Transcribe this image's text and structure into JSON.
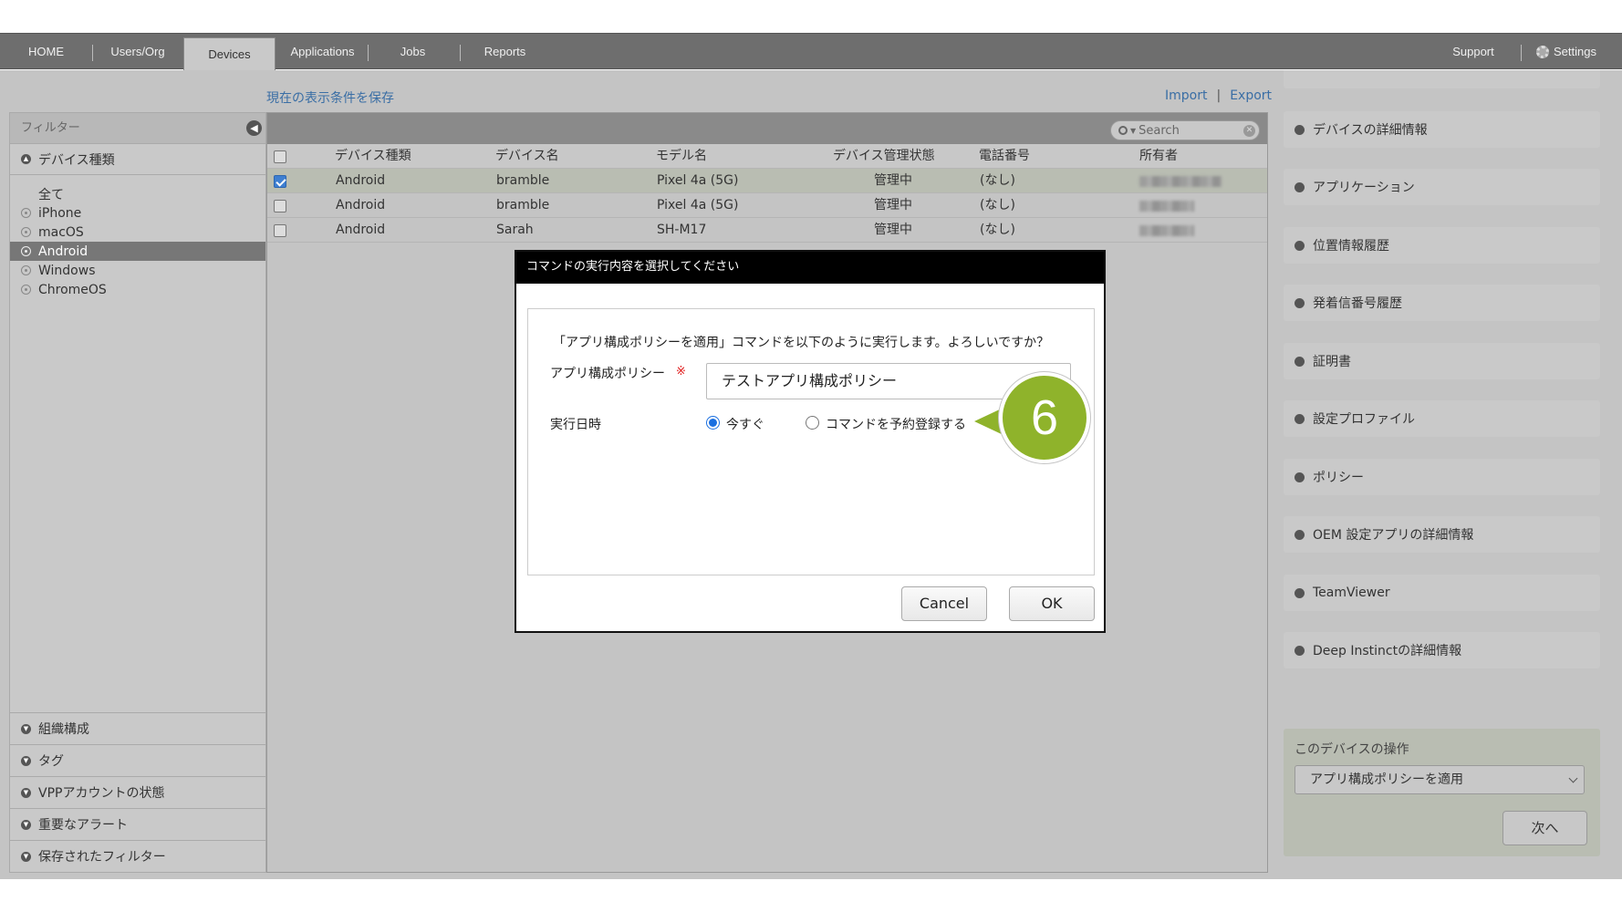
{
  "nav": {
    "tabs": [
      {
        "label": "HOME"
      },
      {
        "label": "Users/Org"
      },
      {
        "label": "Devices"
      },
      {
        "label": "Applications"
      },
      {
        "label": "Jobs"
      },
      {
        "label": "Reports"
      }
    ],
    "support": "Support",
    "settings": "Settings"
  },
  "toolbar": {
    "save_view": "現在の表示条件を保存",
    "import": "Import",
    "sep": "|",
    "export": "Export"
  },
  "filter": {
    "title": "フィルター",
    "device_type": "デバイス種類",
    "items": [
      "全て",
      "iPhone",
      "macOS",
      "Android",
      "Windows",
      "ChromeOS"
    ],
    "active_item": "Android",
    "bottom_sections": [
      "組織構成",
      "タグ",
      "VPPアカウントの状態",
      "重要なアラート",
      "保存されたフィルター"
    ]
  },
  "table": {
    "search_placeholder": "Search",
    "headers": [
      "デバイス種類",
      "デバイス名",
      "モデル名",
      "デバイス管理状態",
      "電話番号",
      "所有者"
    ],
    "rows": [
      {
        "type": "Android",
        "name": "bramble",
        "model": "Pixel 4a (5G)",
        "status": "管理中",
        "phone": "(なし)",
        "checked": true
      },
      {
        "type": "Android",
        "name": "bramble",
        "model": "Pixel 4a (5G)",
        "status": "管理中",
        "phone": "(なし)",
        "checked": false
      },
      {
        "type": "Android",
        "name": "Sarah",
        "model": "SH-M17",
        "status": "管理中",
        "phone": "(なし)",
        "checked": false
      }
    ]
  },
  "right_panel": {
    "items": [
      "デバイスの詳細情報",
      "アプリケーション",
      "位置情報履歴",
      "発着信番号履歴",
      "証明書",
      "設定プロファイル",
      "ポリシー",
      "OEM 設定アプリの詳細情報",
      "TeamViewer",
      "Deep Instinctの詳細情報"
    ],
    "operation_title": "このデバイスの操作",
    "operation_selected": "アプリ構成ポリシーを適用",
    "next_button": "次へ"
  },
  "modal": {
    "title": "コマンドの実行内容を選択してください",
    "message": "「アプリ構成ポリシーを適用」コマンドを以下のように実行します。よろしいですか？",
    "policy_label": "アプリ構成ポリシー",
    "required_mark": "※",
    "policy_value": "テストアプリ構成ポリシー",
    "datetime_label": "実行日時",
    "option_now": "今すぐ",
    "option_schedule": "コマンドを予約登録する",
    "cancel": "Cancel",
    "ok": "OK"
  },
  "step_badge": "6",
  "colors": {
    "nav_bg": "#6e6e6e",
    "page_bg": "#c4c4c4",
    "badge": "#8fb32b",
    "link": "#3a6ea5",
    "radio_on": "#1a6fe0"
  }
}
